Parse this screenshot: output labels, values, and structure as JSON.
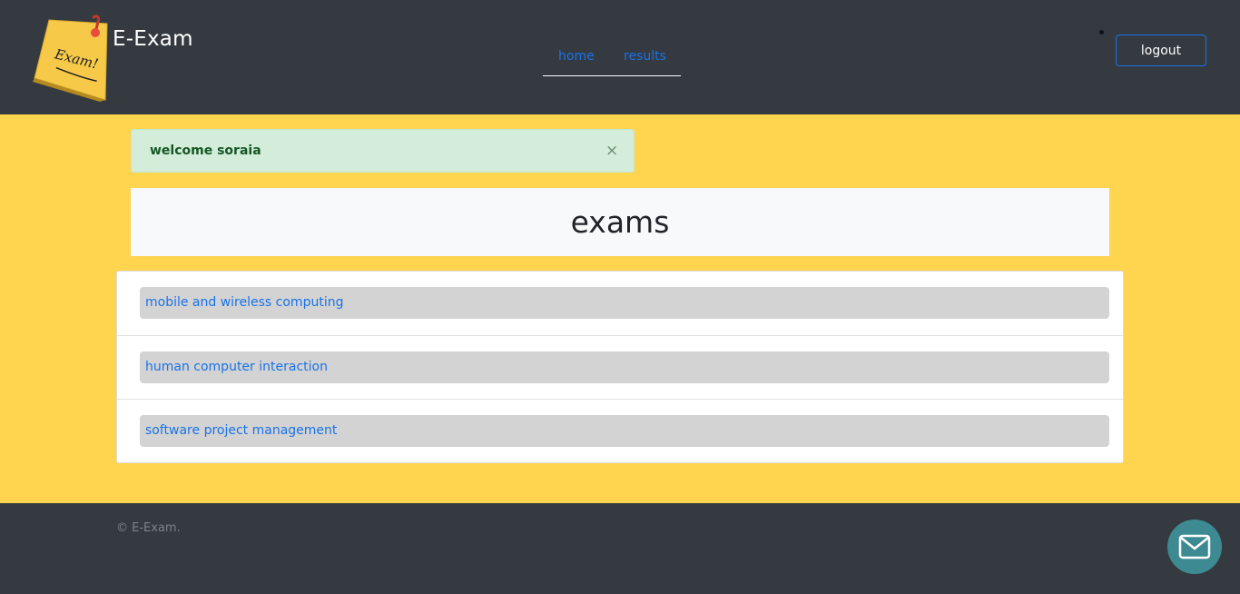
{
  "header": {
    "brand": "E-Exam",
    "logo_text": "Exam!",
    "nav": {
      "home": "home",
      "results": "results"
    },
    "logout_label": "logout"
  },
  "alert": {
    "message": "welcome soraia",
    "close": "×"
  },
  "exams": {
    "title": "exams",
    "items": [
      {
        "label": "mobile and wireless computing"
      },
      {
        "label": "human computer interaction"
      },
      {
        "label": "software project management"
      }
    ]
  },
  "footer": {
    "copyright": "© E-Exam."
  },
  "icons": {
    "logo": "sticky-note-logo-icon",
    "contact": "mail-icon"
  },
  "colors": {
    "header_bg": "#343a40",
    "main_bg": "#ffd54f",
    "link": "#1a73e8",
    "alert_bg": "#d4edda",
    "contact_bg": "#3e8a92"
  }
}
